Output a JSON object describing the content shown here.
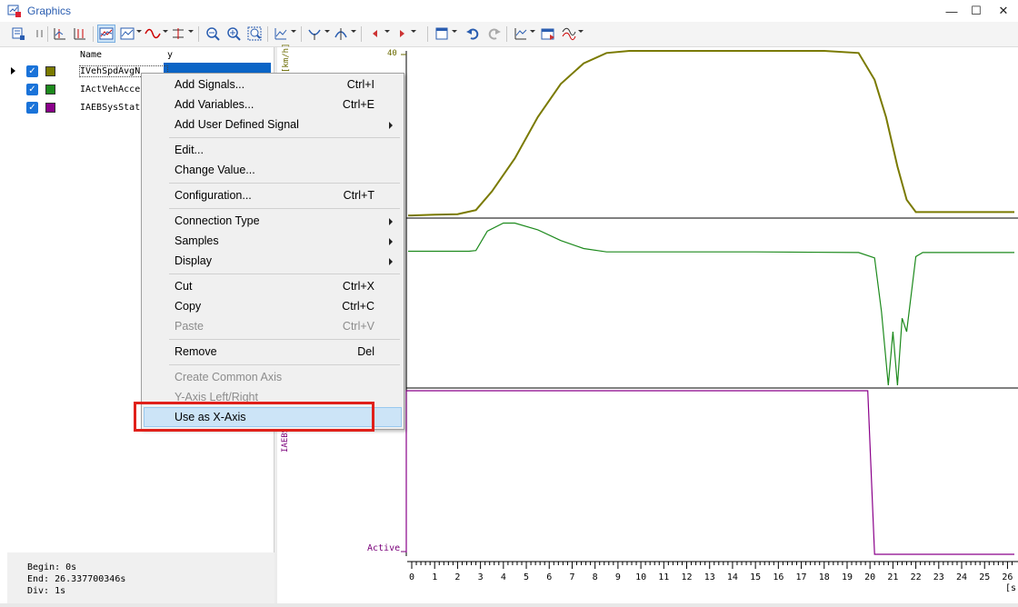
{
  "window": {
    "title": "Graphics",
    "minimize_glyph": "—",
    "maximize_glyph": "☐",
    "close_glyph": "✕"
  },
  "toolbar": {
    "icons": [
      "signal-list-icon",
      "pause-icon",
      "cursor-left-icon",
      "cursor-both-icon",
      "graphic-view-icon",
      "graphic-view-options-icon",
      "signal-style-icon",
      "measure-icon",
      "zoom-out-icon",
      "zoom-in-icon",
      "zoom-fit-icon",
      "axis-settings-icon",
      "marker-icon",
      "marker-options-icon",
      "prev-icon",
      "next-icon",
      "layout-icon",
      "undo-icon",
      "redo-icon",
      "config-icon",
      "export-icon",
      "signal-options-icon"
    ]
  },
  "signal_list": {
    "columns": {
      "name": "Name",
      "y": "y"
    },
    "rows": [
      {
        "name": "IVehSpdAvgN",
        "y": "_",
        "color": "#7a7a00",
        "checked": true,
        "selected": true
      },
      {
        "name": "IActVehAcce",
        "y": "",
        "color": "#1d8a1d",
        "checked": true,
        "selected": false
      },
      {
        "name": "IAEBSysStat",
        "y": "",
        "color": "#8a008a",
        "checked": true,
        "selected": false
      }
    ],
    "check_glyph": "✓",
    "status": {
      "begin": "Begin: 0s",
      "end": "End: 26.337700346s",
      "div": "Div: 1s"
    }
  },
  "plot": {
    "top_axis_max": "40",
    "top_axis_unit": "[km/h]",
    "bottom_axis_state": "Active",
    "bottom_axis_signal": "IAEBS",
    "x_unit": "[s",
    "colors": {
      "speed": "#7a7a00",
      "accel": "#1d8a1d",
      "aeb": "#8a008a"
    }
  },
  "chart_data": [
    {
      "type": "line",
      "title": "",
      "xlabel": "[s",
      "ylabel": "[km/h]",
      "series": [
        {
          "name": "IVehSpdAvgN",
          "x": [
            0,
            1,
            2,
            2.8,
            3.5,
            4.5,
            5.5,
            6.5,
            7.5,
            8.5,
            9.5,
            12,
            15,
            18,
            19.5,
            20.2,
            20.7,
            21.2,
            21.6,
            22,
            23,
            26.3
          ],
          "y": [
            0.2,
            0.4,
            0.5,
            1.5,
            6,
            14,
            24,
            32,
            37,
            39.5,
            40,
            40,
            40,
            40,
            39.5,
            33,
            24,
            12,
            4,
            1,
            1,
            1
          ]
        }
      ],
      "ylim": [
        0,
        40
      ],
      "xlim": [
        0,
        26.3
      ]
    },
    {
      "type": "line",
      "series": [
        {
          "name": "IActVehAcce",
          "x": [
            0,
            2.5,
            2.8,
            3.3,
            4,
            4.5,
            5.5,
            6.5,
            7.5,
            8.5,
            10,
            15,
            19.5,
            20.2,
            20.5,
            20.8,
            21,
            21.2,
            21.4,
            21.6,
            22,
            22.3,
            26.3
          ],
          "y": [
            0,
            0,
            0.05,
            1.5,
            2.1,
            2.1,
            1.6,
            0.8,
            0.2,
            -0.05,
            -0.05,
            -0.05,
            -0.1,
            -0.5,
            -4.5,
            -10,
            -6,
            -10,
            -5,
            -6,
            -0.4,
            -0.1,
            -0.1
          ]
        }
      ]
    },
    {
      "type": "line",
      "series": [
        {
          "name": "IAEBSysStat",
          "x": [
            0.6,
            19.9,
            20.2,
            26.3
          ],
          "y": [
            1,
            1,
            0,
            0
          ]
        }
      ],
      "y_tick_labels": [
        "Active"
      ]
    }
  ],
  "x_ticks": [
    "0",
    "1",
    "2",
    "3",
    "4",
    "5",
    "6",
    "7",
    "8",
    "9",
    "10",
    "11",
    "12",
    "13",
    "14",
    "15",
    "16",
    "17",
    "18",
    "19",
    "20",
    "21",
    "22",
    "23",
    "24",
    "25",
    "26"
  ],
  "context_menu": {
    "items": [
      {
        "key": "add_signals",
        "label": "Add Signals...",
        "shortcut": "Ctrl+I"
      },
      {
        "key": "add_variables",
        "label": "Add Variables...",
        "shortcut": "Ctrl+E"
      },
      {
        "key": "add_user_signal",
        "label": "Add User Defined Signal",
        "shortcut": ""
      },
      {
        "key": "edit",
        "label": "Edit...",
        "shortcut": ""
      },
      {
        "key": "change_value",
        "label": "Change Value...",
        "shortcut": ""
      },
      {
        "key": "configuration",
        "label": "Configuration...",
        "shortcut": "Ctrl+T"
      },
      {
        "key": "connection_type",
        "label": "Connection Type",
        "shortcut": ""
      },
      {
        "key": "samples",
        "label": "Samples",
        "shortcut": ""
      },
      {
        "key": "display",
        "label": "Display",
        "shortcut": ""
      },
      {
        "key": "cut",
        "label": "Cut",
        "shortcut": "Ctrl+X"
      },
      {
        "key": "copy",
        "label": "Copy",
        "shortcut": "Ctrl+C"
      },
      {
        "key": "paste",
        "label": "Paste",
        "shortcut": "Ctrl+V"
      },
      {
        "key": "remove",
        "label": "Remove",
        "shortcut": "Del"
      },
      {
        "key": "create_common_axis",
        "label": "Create Common Axis",
        "shortcut": ""
      },
      {
        "key": "y_axis_left_right",
        "label": "Y-Axis Left/Right",
        "shortcut": ""
      },
      {
        "key": "use_as_x_axis",
        "label": "Use as X-Axis",
        "shortcut": ""
      }
    ]
  }
}
